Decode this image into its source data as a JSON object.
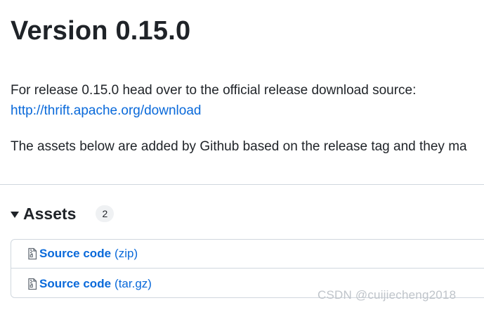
{
  "release": {
    "title": "Version 0.15.0",
    "intro_text": "For release 0.15.0 head over to the official release download source:",
    "download_link": "http://thrift.apache.org/download",
    "assets_note": "The assets below are added by Github based on the release tag and they ma"
  },
  "assets": {
    "label": "Assets",
    "count": "2",
    "items": [
      {
        "name": "Source code",
        "ext": "(zip)",
        "icon": "file-zip-icon"
      },
      {
        "name": "Source code",
        "ext": "(tar.gz)",
        "icon": "file-zip-icon"
      }
    ]
  },
  "watermark": "CSDN @cuijiecheng2018",
  "colors": {
    "link": "#0969da",
    "text": "#1f2328",
    "border": "#d0d7de",
    "counter_bg": "#eff1f3"
  }
}
